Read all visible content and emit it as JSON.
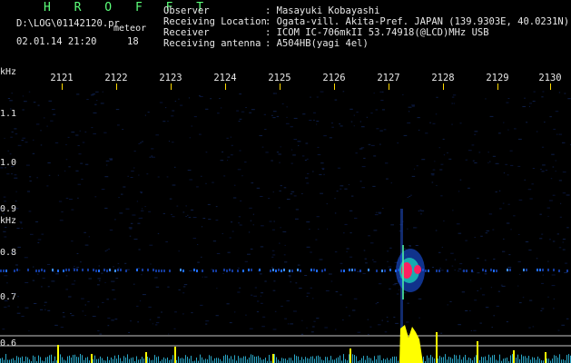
{
  "header": {
    "logo": "H R O F F T",
    "path": "D:\\LOG\\01142120.pr",
    "mode": "meteor",
    "datetime": "02.01.14 21:20",
    "count": "18",
    "info_labels": [
      "Observer",
      "Receiving Location",
      "Receiver",
      "Receiving antenna"
    ],
    "info_values": [
      ": Masayuki Kobayashi",
      ": Ogata-vill. Akita-Pref. JAPAN (139.9303E, 40.0231N)",
      ": ICOM IC-706mkII 53.74918(@LCD)MHz USB",
      ": A504HB(yagi 4el)"
    ]
  },
  "spectrogram": {
    "top_unit": "kHz",
    "top_labels": [
      "2121",
      "2122",
      "2123",
      "2124",
      "2125",
      "2126",
      "2127",
      "2128",
      "2129",
      "2130"
    ],
    "left_unit": "kHz",
    "left_labels": [
      "1.1",
      "1.0",
      "0.9",
      "0.8",
      "0.7",
      "0.6"
    ],
    "carrier_khz": 0.76,
    "meteor_echo_time": "2127.3"
  },
  "colors": {
    "text": "#e8e8e8",
    "logo": "#5cff7a",
    "tick": "#ffd800",
    "trace": "#ffff00",
    "signal_hot": "#ff2060",
    "signal_cool": "#1e6bff"
  }
}
